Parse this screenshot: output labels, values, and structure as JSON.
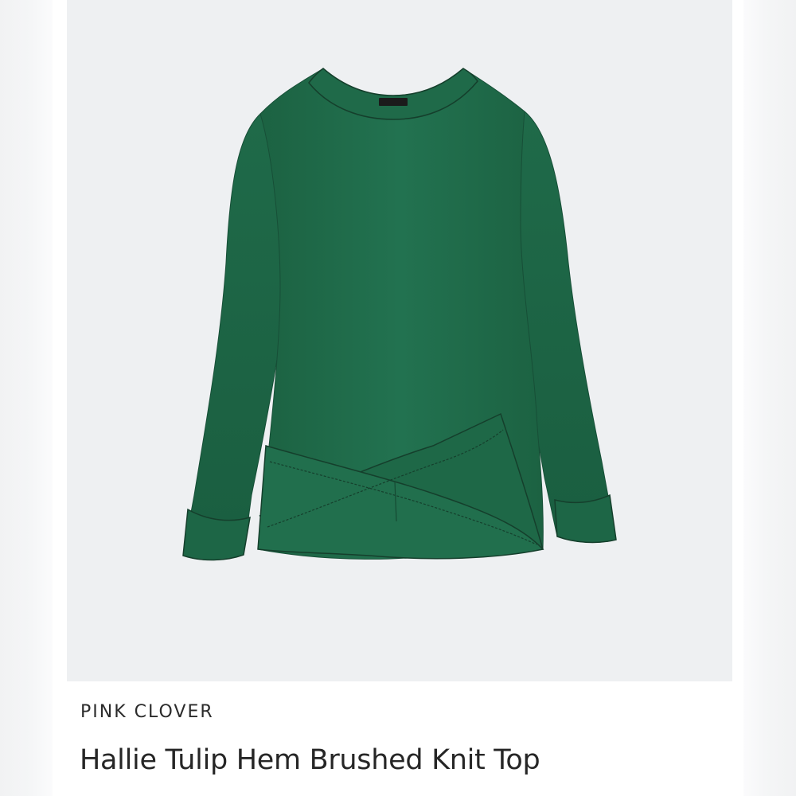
{
  "product": {
    "brand": "PINK CLOVER",
    "title": "Hallie Tulip Hem Brushed Knit Top",
    "image_alt": "Green long-sleeve brushed knit top with tulip hem",
    "garment_color": "#1f6b48",
    "image_background": "#eef0f2"
  }
}
